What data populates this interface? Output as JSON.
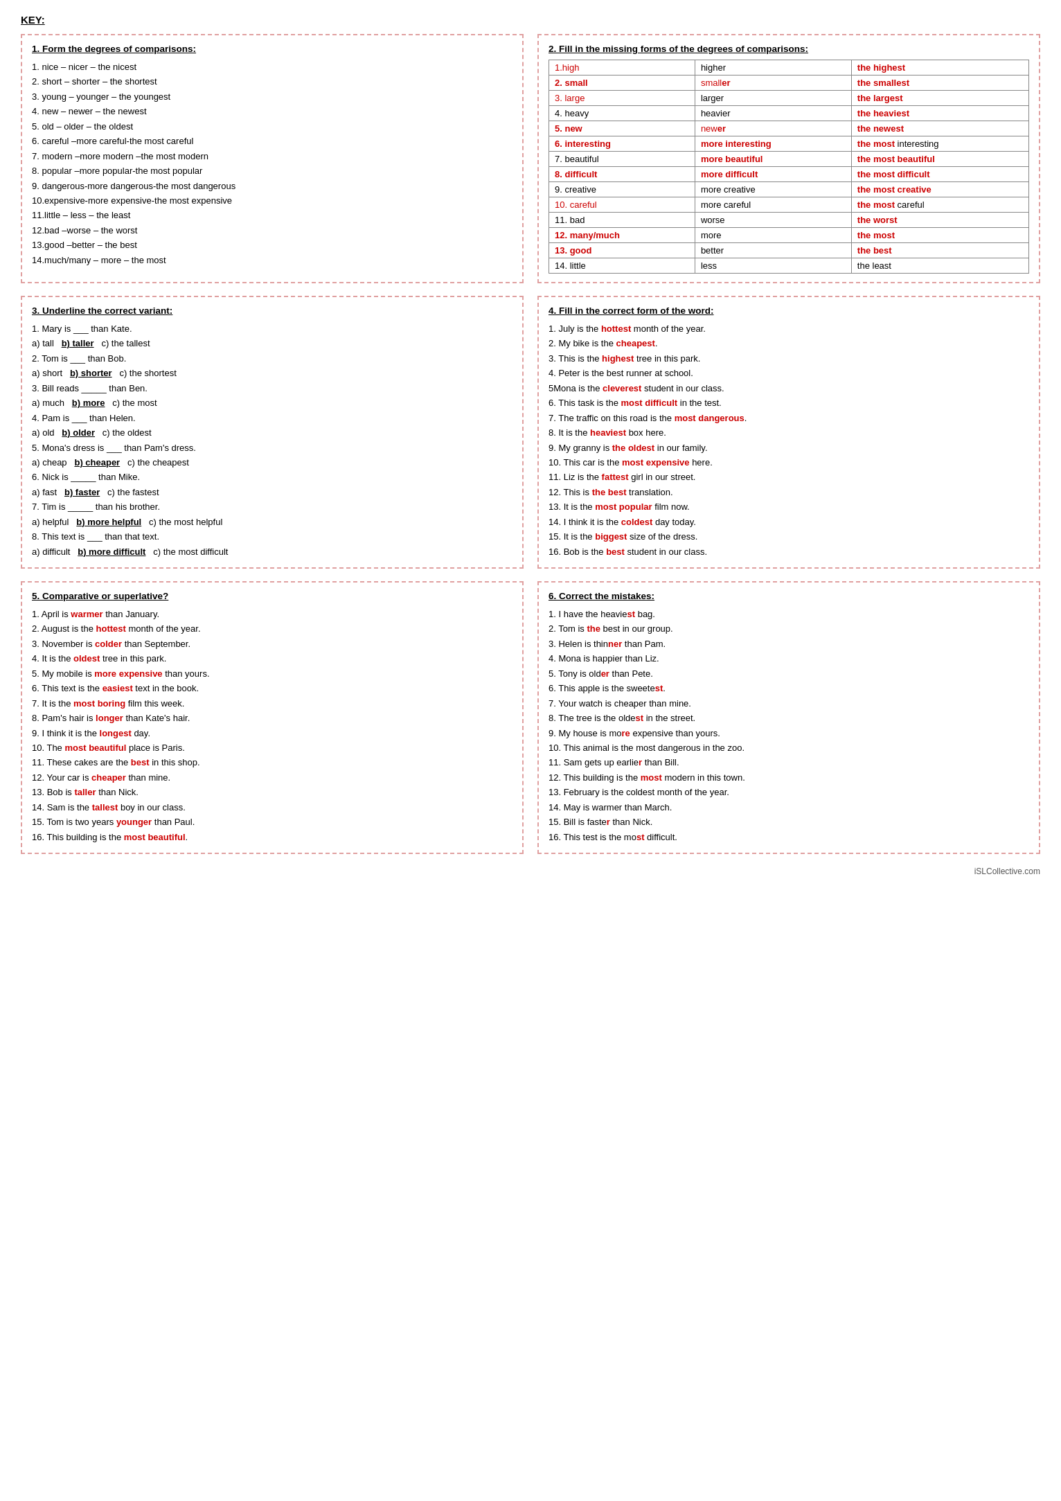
{
  "title": "KEY:",
  "section1": {
    "title": "1. Form the degrees of comparisons:",
    "lines": [
      "1. nice – nicer – the nicest",
      "2. short – shorter – the shortest",
      "3. young – younger – the youngest",
      "4. new – newer – the newest",
      "5. old – older – the oldest",
      "6. careful –more careful-the most careful",
      "7. modern –more modern –the most modern",
      "8. popular –more popular-the most popular",
      "9. dangerous-more dangerous-the most dangerous",
      "10.expensive-more expensive-the most expensive",
      "11.little – less – the least",
      "12.bad –worse – the worst",
      "13.good –better – the best",
      "14.much/many – more – the most"
    ]
  },
  "section2": {
    "title": "2. Fill in the missing forms of the degrees of comparisons:",
    "rows": [
      {
        "base": "1.high",
        "comp": "higher",
        "super": "the highest",
        "base_red": true,
        "comp_red": false,
        "super_red": true
      },
      {
        "base": "2. small",
        "comp": "smaller",
        "super": "the smallest",
        "base_red": true,
        "comp_red": true,
        "super_red": true
      },
      {
        "base": "3. large",
        "comp": "larger",
        "super": "the largest",
        "base_red": true,
        "comp_red": false,
        "super_red": true
      },
      {
        "base": "4. heavy",
        "comp": "heavier",
        "super": "the heaviest",
        "base_red": false,
        "comp_red": false,
        "super_red": true
      },
      {
        "base": "5. new",
        "comp": "newer",
        "super": "the newest",
        "base_red": true,
        "comp_red": true,
        "super_red": true
      },
      {
        "base": "6. interesting",
        "comp": "more interesting",
        "super": "the most interesting",
        "base_red": true,
        "comp_red": true,
        "super_red": true,
        "super_mixed": true
      },
      {
        "base": "7. beautiful",
        "comp": "more beautiful",
        "super": "the most beautiful",
        "base_red": false,
        "comp_red": true,
        "super_red": true
      },
      {
        "base": "8. difficult",
        "comp": "more difficult",
        "super": "the most difficult",
        "base_red": true,
        "comp_red": true,
        "super_red": true,
        "super_mixed": true
      },
      {
        "base": "9. creative",
        "comp": "more creative",
        "super": "the most creative",
        "base_red": false,
        "comp_red": false,
        "super_red": true
      },
      {
        "base": "10. careful",
        "comp": "more careful",
        "super": "the most careful",
        "base_red": true,
        "comp_red": false,
        "super_red": true,
        "super_mixed": true
      },
      {
        "base": "11. bad",
        "comp": "worse",
        "super": "the worst",
        "base_red": false,
        "comp_red": false,
        "super_red": true
      },
      {
        "base": "12. many/much",
        "comp": "more",
        "super": "the most",
        "base_red": true,
        "comp_red": false,
        "super_red": true
      },
      {
        "base": "13. good",
        "comp": "better",
        "super": "the best",
        "base_red": true,
        "comp_red": false,
        "super_red": true
      },
      {
        "base": "14. little",
        "comp": "less",
        "super": "the least",
        "base_red": false,
        "comp_red": false,
        "super_red": false
      }
    ]
  },
  "section3": {
    "title": "3. Underline the correct variant:",
    "lines": [
      {
        "text": "1. Mary is ___ than Kate."
      },
      {
        "text": "a) tall   b) taller   c) the tallest",
        "b_underline": "taller"
      },
      {
        "text": "2. Tom is ___ than Bob."
      },
      {
        "text": "a) short   b) shorter   c) the shortest",
        "b_underline": "shorter"
      },
      {
        "text": "3. Bill reads _____ than Ben."
      },
      {
        "text": "a) much   b) more   c) the most",
        "b_underline": "more"
      },
      {
        "text": "4. Pam is ___ than Helen."
      },
      {
        "text": "a) old   b) older   c) the oldest",
        "b_underline": "older"
      },
      {
        "text": "5. Mona's dress is ___ than Pam's dress."
      },
      {
        "text": "a) cheap   b) cheaper   c) the cheapest",
        "b_underline": "cheaper"
      },
      {
        "text": "6. Nick is _____ than Mike."
      },
      {
        "text": "a) fast   b) faster   c) the fastest",
        "b_underline": "faster"
      },
      {
        "text": "7. Tim is _____ than his brother."
      },
      {
        "text": "a) helpful   b) more helpful   c) the most helpful",
        "b_underline": "more helpful"
      },
      {
        "text": "8. This text is ___ than that text."
      },
      {
        "text": "a) difficult   b) more difficult   c) the most difficult",
        "b_underline": "more difficult"
      }
    ]
  },
  "section4": {
    "title": "4. Fill in the correct form of the word:",
    "lines": [
      "1. July is the <r>hottest</r> month of the year.",
      "2. My bike is the <r>cheapest</r>.",
      "3. This is the <r>highest</r> tree in this park.",
      "4. Peter is the best runner at school.",
      "5Mona is the <r>cleverest</r> student in our class.",
      "6. This task is the <r>most difficult</r> in the test.",
      "7. The traffic on this road is the <r>most dangerous</r>.",
      "8. It is the <r>heaviest</r> box here.",
      "9. My granny is <r>the oldest</r> in our family.",
      "10. This car is the <r>most expensive</r> here.",
      "11. Liz is the <r>fattest</r> girl in our street.",
      "12. This is <r>the best</r> translation.",
      "13. It is the <r>most popular</r> film now.",
      "14. I think it is the <r>coldest</r> day today.",
      "15. It is the <r>biggest</r> size of the dress.",
      "16. Bob is the <r>best</r> student in our class."
    ]
  },
  "section5": {
    "title": "5. Comparative or superlative?",
    "lines": [
      "1. April is <r>warmer</r> than January.",
      "2. August is the <r>hottest</r> month of the year.",
      "3. November is <r>colder</r> than September.",
      "4. It is the <r>oldest</r> tree in this park.",
      "5. My mobile is <r>more expensive</r> than yours.",
      "6. This text is the <r>easiest</r> text in the book.",
      "7. It is the <r>most boring</r> film this week.",
      "8. Pam's hair is <r>longer</r> than Kate's hair.",
      "9. I think it is the <r>longest</r> day.",
      "10. The <r>most beautiful</r> place is Paris.",
      "11. These cakes are the <r>best</r> in this shop.",
      "12. Your car is <r>cheaper</r> than mine.",
      "13. Bob is <r>taller</r> than Nick.",
      "14. Sam is the <r>tallest</r> boy in our class.",
      "15. Tom is two years <r>younger</r> than Paul.",
      "16. This building is the <r>most beautiful</r>."
    ]
  },
  "section6": {
    "title": "6. Correct the mistakes:",
    "lines": [
      "1. I have the heavie<r>st</r> bag.",
      "2. Tom is <r>the</r> best in our group.",
      "3. Helen is thin<r>ner</r> than Pam.",
      "4. Mona is happier than Liz.",
      "5. Tony is old<r>er</r> than Pete.",
      "6. This apple is the sweete<r>st</r>.",
      "7. Your watch is cheaper than mine.",
      "8. The tree is the olde<r>st</r> in the street.",
      "9. My house is mo<r>re</r> expensive than yours.",
      "10. This animal is the most dangerous in the zoo.",
      "11. Sam gets up earlie<r>r</r> than Bill.",
      "12. This building is the <r>most</r> modern in this town.",
      "13. February is the coldest month of the year.",
      "14. May is warmer than March.",
      "15. Bill is faste<r>r</r> than Nick.",
      "16. This test is the mo<r>st</r> difficult."
    ]
  },
  "footer": "iSLCollective.com"
}
